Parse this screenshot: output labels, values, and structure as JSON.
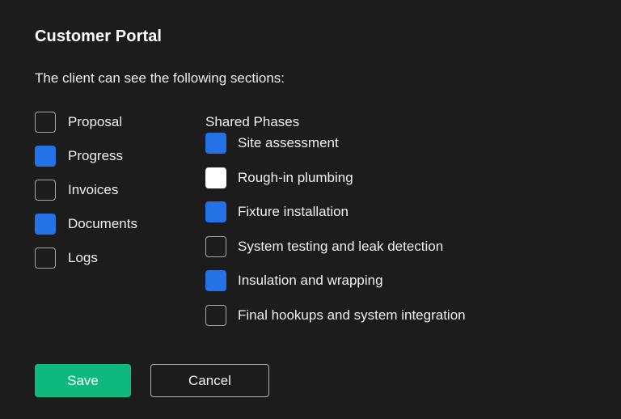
{
  "dialog": {
    "title": "Customer Portal",
    "subtitle": "The client can see the following sections:"
  },
  "sections": {
    "items": [
      {
        "label": "Proposal",
        "state": "unchecked"
      },
      {
        "label": "Progress",
        "state": "checked"
      },
      {
        "label": "Invoices",
        "state": "unchecked"
      },
      {
        "label": "Documents",
        "state": "checked"
      },
      {
        "label": "Logs",
        "state": "unchecked"
      }
    ]
  },
  "shared_phases": {
    "header": "Shared Phases",
    "items": [
      {
        "label": "Site assessment",
        "state": "checked"
      },
      {
        "label": "Rough-in plumbing",
        "state": "white"
      },
      {
        "label": "Fixture installation",
        "state": "checked"
      },
      {
        "label": "System testing and leak detection",
        "state": "unchecked"
      },
      {
        "label": "Insulation and wrapping",
        "state": "checked"
      },
      {
        "label": "Final hookups and system integration",
        "state": "unchecked"
      }
    ]
  },
  "footer": {
    "save_label": "Save",
    "cancel_label": "Cancel"
  },
  "colors": {
    "background": "#1c1c1c",
    "checkbox_checked": "#2571e6",
    "checkbox_white": "#ffffff",
    "checkbox_border": "#a8a8a8",
    "save_button": "#0fb97d",
    "cancel_border": "#b0b0b0",
    "text": "#f0f0f0"
  }
}
